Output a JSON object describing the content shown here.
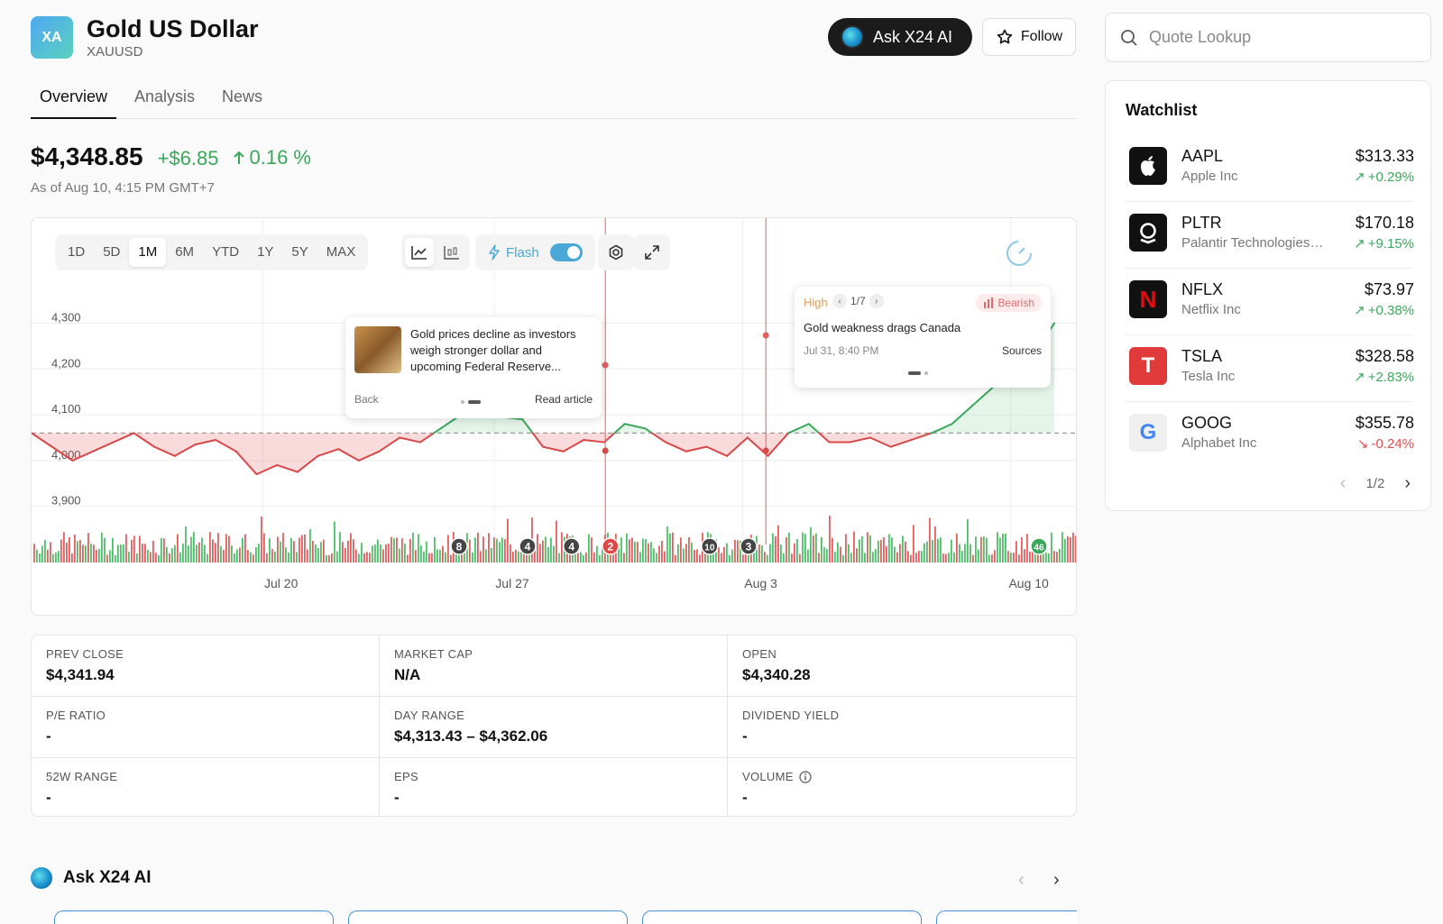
{
  "header": {
    "logo_text": "XA",
    "title": "Gold US Dollar",
    "symbol": "XAUUSD",
    "ask_label": "Ask X24 AI",
    "follow_label": "Follow"
  },
  "tabs": [
    {
      "label": "Overview",
      "active": true
    },
    {
      "label": "Analysis",
      "active": false
    },
    {
      "label": "News",
      "active": false
    }
  ],
  "quote": {
    "price": "$4,348.85",
    "change": "+$6.85",
    "change_pct": "0.16 %",
    "as_of": "As of Aug 10, 4:15 PM GMT+7"
  },
  "chart_toolbar": {
    "ranges": [
      "1D",
      "5D",
      "1M",
      "6M",
      "YTD",
      "1Y",
      "5Y",
      "MAX"
    ],
    "active_range": "1M",
    "flash_label": "Flash"
  },
  "news_popup": {
    "text": "Gold prices decline as investors weigh stronger dollar and upcoming Federal Reserve...",
    "back": "Back",
    "read": "Read article"
  },
  "insight_popup": {
    "level": "High",
    "page": "1/7",
    "sentiment": "Bearish",
    "title": "Gold weakness drags Canada",
    "date": "Jul 31, 8:40 PM",
    "sources": "Sources"
  },
  "chart_data": {
    "type": "area",
    "baseline": 4060,
    "ylim": [
      3860,
      4360
    ],
    "yticks": [
      3900,
      4000,
      4100,
      4200,
      4300
    ],
    "xtick_labels": [
      "Jul 20",
      "Jul 27",
      "Aug 3",
      "Aug 10"
    ],
    "x": [
      0,
      0.02,
      0.04,
      0.06,
      0.08,
      0.1,
      0.12,
      0.14,
      0.16,
      0.18,
      0.2,
      0.22,
      0.24,
      0.26,
      0.28,
      0.3,
      0.32,
      0.34,
      0.36,
      0.38,
      0.4,
      0.42,
      0.44,
      0.46,
      0.48,
      0.5,
      0.52,
      0.54,
      0.56,
      0.58,
      0.6,
      0.62,
      0.64,
      0.66,
      0.68,
      0.7,
      0.72,
      0.74,
      0.76,
      0.78,
      0.8,
      0.82,
      0.84,
      0.86,
      0.88,
      0.9,
      0.92,
      0.94,
      0.96,
      0.98,
      1.0
    ],
    "values": [
      4060,
      4030,
      4000,
      4020,
      4040,
      4060,
      4030,
      4010,
      4035,
      4045,
      4020,
      3970,
      3990,
      3975,
      4010,
      4025,
      4000,
      4020,
      4050,
      4040,
      4070,
      4100,
      4110,
      4095,
      4090,
      4030,
      4020,
      4045,
      4040,
      4080,
      4070,
      4040,
      4020,
      4030,
      4010,
      4050,
      4010,
      4060,
      4080,
      4040,
      4040,
      4050,
      4030,
      4045,
      4060,
      4080,
      4120,
      4160,
      4200,
      4230,
      4300
    ],
    "volume_markers": [
      {
        "label": "8",
        "pos": 0.418,
        "color": "#444"
      },
      {
        "label": "4",
        "pos": 0.485,
        "color": "#444"
      },
      {
        "label": "4",
        "pos": 0.528,
        "color": "#444"
      },
      {
        "label": "2",
        "pos": 0.566,
        "color": "#e04848"
      },
      {
        "label": "10",
        "pos": 0.663,
        "color": "#444"
      },
      {
        "label": "3",
        "pos": 0.701,
        "color": "#444"
      },
      {
        "label": "46",
        "pos": 0.985,
        "color": "#3aa85a"
      }
    ]
  },
  "stats": [
    {
      "label": "PREV CLOSE",
      "value": "$4,341.94"
    },
    {
      "label": "MARKET CAP",
      "value": "N/A"
    },
    {
      "label": "OPEN",
      "value": "$4,340.28"
    },
    {
      "label": "P/E RATIO",
      "value": "-"
    },
    {
      "label": "DAY RANGE",
      "value": "$4,313.43 – $4,362.06"
    },
    {
      "label": "DIVIDEND YIELD",
      "value": "-"
    },
    {
      "label": "52W RANGE",
      "value": "-"
    },
    {
      "label": "EPS",
      "value": "-"
    },
    {
      "label": "VOLUME",
      "value": "-"
    }
  ],
  "ai_section": {
    "title": "Ask X24 AI"
  },
  "search": {
    "placeholder": "Quote Lookup"
  },
  "watchlist": {
    "title": "Watchlist",
    "page": "1/2",
    "items": [
      {
        "symbol": "AAPL",
        "name": "Apple Inc",
        "price": "$313.33",
        "change": "+0.29%",
        "dir": "up",
        "logo_bg": "#111",
        "logo_char": ""
      },
      {
        "symbol": "PLTR",
        "name": "Palantir Technologies Inc",
        "price": "$170.18",
        "change": "+9.15%",
        "dir": "up",
        "logo_bg": "#111",
        "logo_char": ""
      },
      {
        "symbol": "NFLX",
        "name": "Netflix Inc",
        "price": "$73.97",
        "change": "+0.38%",
        "dir": "up",
        "logo_bg": "#111",
        "logo_char": "N"
      },
      {
        "symbol": "TSLA",
        "name": "Tesla Inc",
        "price": "$328.58",
        "change": "+2.83%",
        "dir": "up",
        "logo_bg": "#e03a3a",
        "logo_char": "T"
      },
      {
        "symbol": "GOOG",
        "name": "Alphabet Inc",
        "price": "$355.78",
        "change": "-0.24%",
        "dir": "dn",
        "logo_bg": "#f0f0f0",
        "logo_char": "G"
      }
    ]
  }
}
